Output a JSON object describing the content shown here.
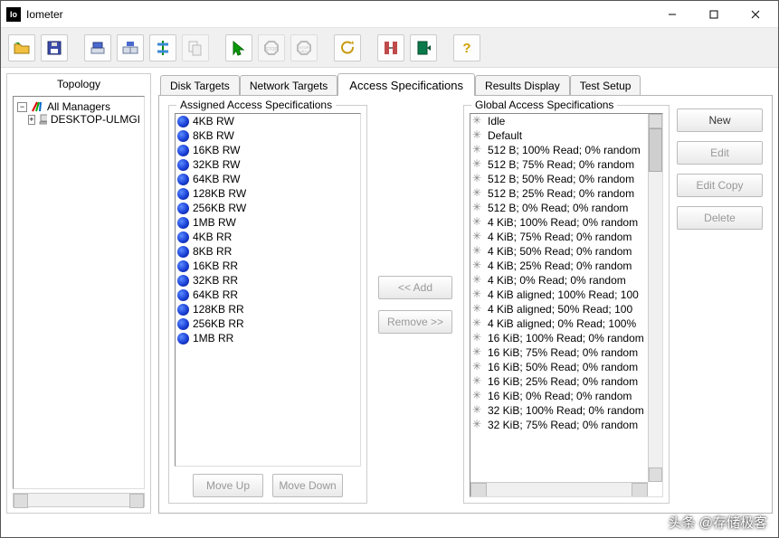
{
  "window": {
    "title": "Iometer",
    "min": "–",
    "max": "□",
    "close": "✕"
  },
  "topology": {
    "heading": "Topology",
    "root": "All Managers",
    "child": "DESKTOP-ULMGI"
  },
  "tabs": {
    "disk": "Disk Targets",
    "network": "Network Targets",
    "access": "Access Specifications",
    "results": "Results Display",
    "setup": "Test Setup"
  },
  "assigned": {
    "legend": "Assigned Access Specifications",
    "items": [
      "4KB RW",
      "8KB RW",
      "16KB RW",
      "32KB RW",
      "64KB RW",
      "128KB RW",
      "256KB RW",
      "1MB RW",
      "4KB RR",
      "8KB RR",
      "16KB RR",
      "32KB RR",
      "64KB RR",
      "128KB RR",
      "256KB RR",
      "1MB RR"
    ],
    "moveUp": "Move Up",
    "moveDown": "Move Down"
  },
  "mid": {
    "add": "<< Add",
    "remove": "Remove >>"
  },
  "global": {
    "legend": "Global Access Specifications",
    "items": [
      "Idle",
      "Default",
      "512 B; 100% Read; 0% random",
      "512 B; 75% Read; 0% random",
      "512 B; 50% Read; 0% random",
      "512 B; 25% Read; 0% random",
      "512 B; 0% Read; 0% random",
      "4 KiB; 100% Read; 0% random",
      "4 KiB; 75% Read; 0% random",
      "4 KiB; 50% Read; 0% random",
      "4 KiB; 25% Read; 0% random",
      "4 KiB; 0% Read; 0% random",
      "4 KiB aligned; 100% Read; 100",
      "4 KiB aligned; 50% Read; 100",
      "4 KiB aligned; 0% Read; 100%",
      "16 KiB; 100% Read; 0% random",
      "16 KiB; 75% Read; 0% random",
      "16 KiB; 50% Read; 0% random",
      "16 KiB; 25% Read; 0% random",
      "16 KiB; 0% Read; 0% random",
      "32 KiB; 100% Read; 0% random",
      "32 KiB; 75% Read; 0% random"
    ]
  },
  "right": {
    "new": "New",
    "edit": "Edit",
    "editCopy": "Edit Copy",
    "delete": "Delete"
  },
  "watermark": "头条 @存储极客"
}
